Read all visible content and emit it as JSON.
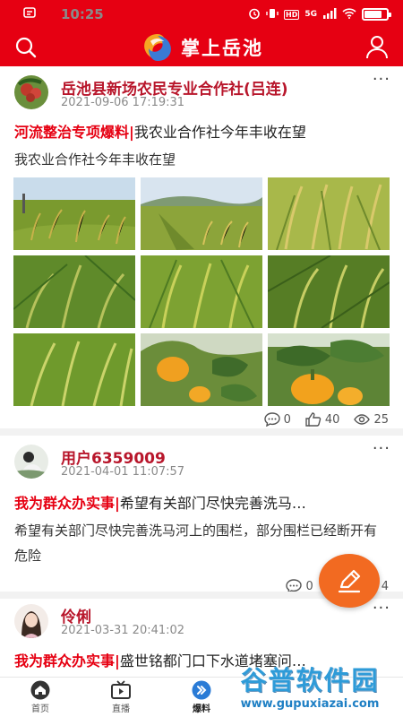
{
  "status_bar": {
    "time": "10:25",
    "network": "5G",
    "hd": "HD",
    "battery_level": 0.8
  },
  "header": {
    "title": "掌上岳池",
    "brand_colors": {
      "red": "#e60012",
      "orange": "#f26a21"
    }
  },
  "posts": [
    {
      "author": "岳池县新场农民专业合作社(吕连)",
      "time": "2021-09-06 17:19:31",
      "tag": "河流整治专项爆料|",
      "headline": "我农业合作社今年丰收在望",
      "body": "我农业合作社今年丰收在望",
      "comments": "0",
      "likes": "40",
      "views": "25",
      "images": [
        "rice-field",
        "rice-field",
        "rice-ears",
        "rice-ears",
        "rice-ears",
        "rice-ears",
        "rice-ears",
        "pumpkin",
        "pumpkin"
      ]
    },
    {
      "author": "用户6359009",
      "time": "2021-04-01 11:07:57",
      "tag": "我为群众办实事|",
      "headline": "希望有关部门尽快完善洗马…",
      "body": "希望有关部门尽快完善洗马河上的围栏，部分围栏已经断开有危险",
      "comments": "0",
      "likes": "",
      "views": "4"
    },
    {
      "author": "伶俐",
      "time": "2021-03-31 20:41:02",
      "tag": "我为群众办实事|",
      "headline": "盛世铭都门口下水道堵塞问…"
    }
  ],
  "tabbar": [
    {
      "label": "首页",
      "icon": "home-icon"
    },
    {
      "label": "直播",
      "icon": "tv-icon"
    },
    {
      "label": "爆料",
      "icon": "report-icon"
    }
  ],
  "watermark": {
    "main": "谷普软件园",
    "url": "www.gupuxiazai.com"
  }
}
